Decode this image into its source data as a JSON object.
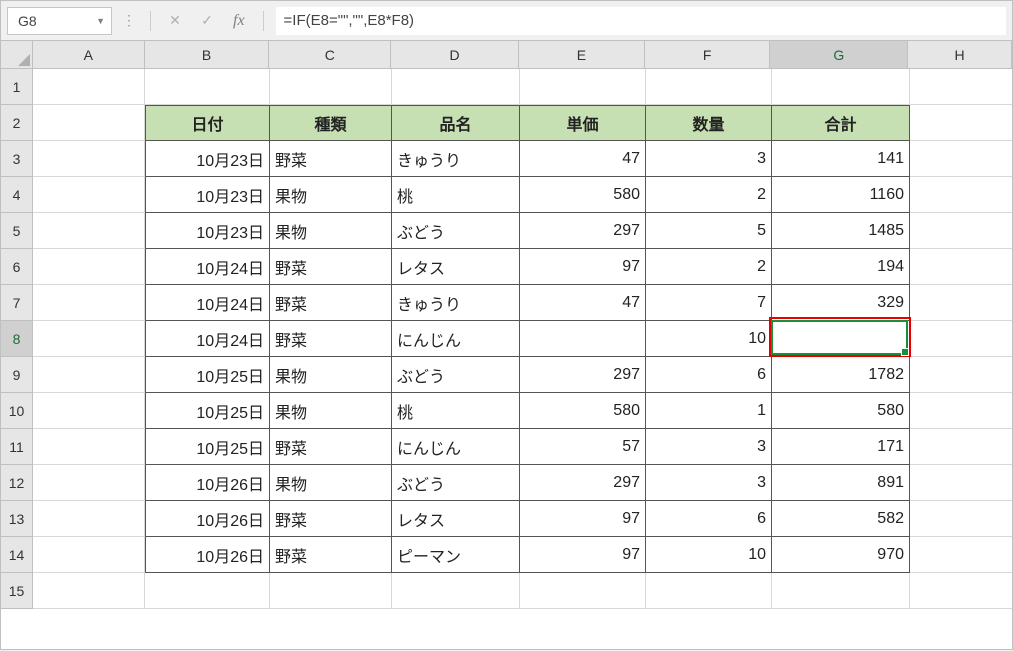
{
  "nameBox": "G8",
  "formula": "=IF(E8=\"\",\"\",E8*F8)",
  "fxLabel": "fx",
  "columns": [
    "A",
    "B",
    "C",
    "D",
    "E",
    "F",
    "G",
    "H"
  ],
  "colWidths": {
    "A": 112,
    "B": 125,
    "C": 122,
    "D": 128,
    "E": 126,
    "F": 126,
    "G": 138,
    "H": 104
  },
  "rowCount": 15,
  "activeCell": {
    "row": 8,
    "col": "G"
  },
  "tableHeaders": {
    "B": "日付",
    "C": "種類",
    "D": "品名",
    "E": "単価",
    "F": "数量",
    "G": "合計"
  },
  "chart_data": {
    "type": "table",
    "columns": [
      "日付",
      "種類",
      "品名",
      "単価",
      "数量",
      "合計"
    ],
    "rows": [
      {
        "日付": "10月23日",
        "種類": "野菜",
        "品名": "きゅうり",
        "単価": 47,
        "数量": 3,
        "合計": 141
      },
      {
        "日付": "10月23日",
        "種類": "果物",
        "品名": "桃",
        "単価": 580,
        "数量": 2,
        "合計": 1160
      },
      {
        "日付": "10月23日",
        "種類": "果物",
        "品名": "ぶどう",
        "単価": 297,
        "数量": 5,
        "合計": 1485
      },
      {
        "日付": "10月24日",
        "種類": "野菜",
        "品名": "レタス",
        "単価": 97,
        "数量": 2,
        "合計": 194
      },
      {
        "日付": "10月24日",
        "種類": "野菜",
        "品名": "きゅうり",
        "単価": 47,
        "数量": 7,
        "合計": 329
      },
      {
        "日付": "10月24日",
        "種類": "野菜",
        "品名": "にんじん",
        "単価": null,
        "数量": 10,
        "合計": null
      },
      {
        "日付": "10月25日",
        "種類": "果物",
        "品名": "ぶどう",
        "単価": 297,
        "数量": 6,
        "合計": 1782
      },
      {
        "日付": "10月25日",
        "種類": "果物",
        "品名": "桃",
        "単価": 580,
        "数量": 1,
        "合計": 580
      },
      {
        "日付": "10月25日",
        "種類": "野菜",
        "品名": "にんじん",
        "単価": 57,
        "数量": 3,
        "合計": 171
      },
      {
        "日付": "10月26日",
        "種類": "果物",
        "品名": "ぶどう",
        "単価": 297,
        "数量": 3,
        "合計": 891
      },
      {
        "日付": "10月26日",
        "種類": "野菜",
        "品名": "レタス",
        "単価": 97,
        "数量": 6,
        "合計": 582
      },
      {
        "日付": "10月26日",
        "種類": "野菜",
        "品名": "ピーマン",
        "単価": 97,
        "数量": 10,
        "合計": 970
      }
    ]
  },
  "tableStartRow": 3,
  "tableHeaderRow": 2,
  "tableCols": [
    "B",
    "C",
    "D",
    "E",
    "F",
    "G"
  ],
  "alignments": {
    "B": "right",
    "C": "left",
    "D": "left",
    "E": "right",
    "F": "right",
    "G": "right"
  }
}
